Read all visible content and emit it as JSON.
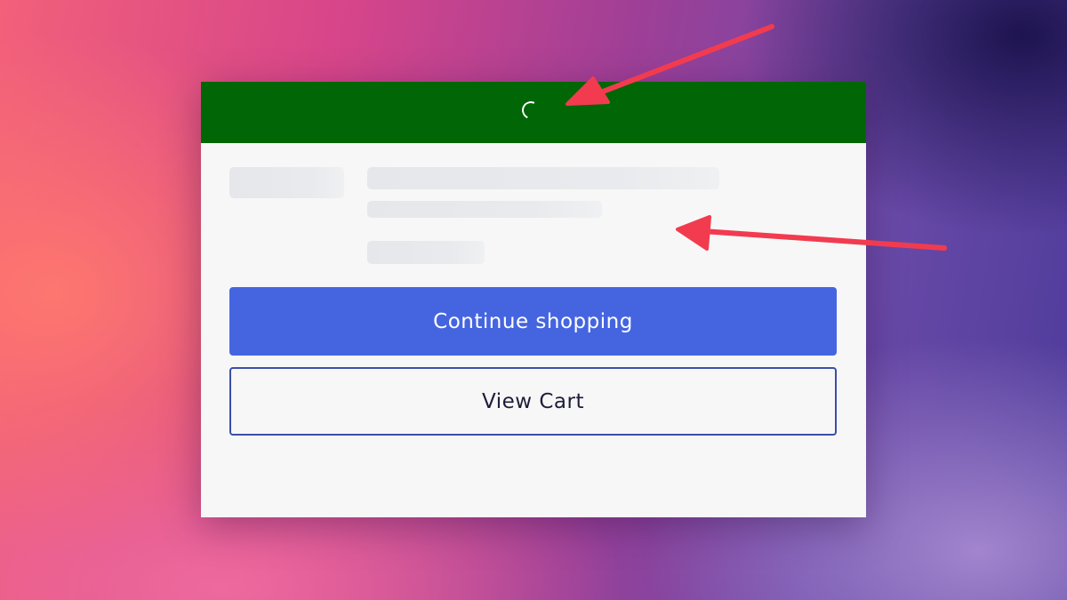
{
  "modal": {
    "header": {
      "color": "#016606",
      "loading_icon": "spinner-icon"
    },
    "skeleton": {
      "placeholder_color": "#e5e7eb"
    },
    "buttons": {
      "continue_label": "Continue shopping",
      "continue_color": "#4565e0",
      "view_cart_label": "View Cart",
      "view_cart_border_color": "#3a4fa8"
    }
  },
  "annotations": {
    "arrow_color": "#f23b4f",
    "arrows": [
      "arrow-to-spinner-icon",
      "arrow-to-skeleton-icon"
    ]
  }
}
